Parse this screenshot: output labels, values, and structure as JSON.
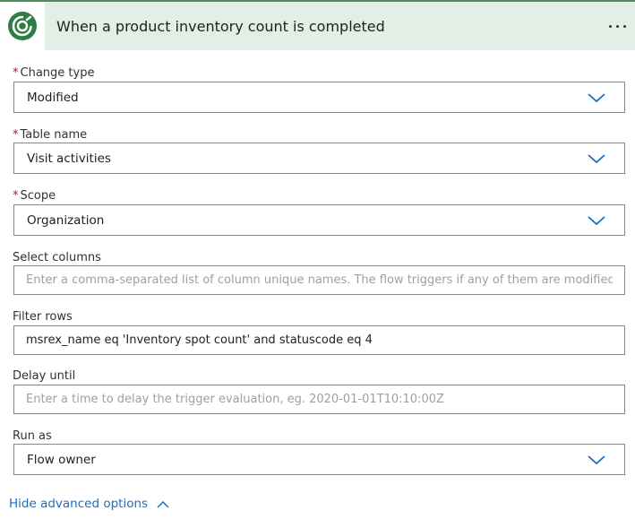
{
  "header": {
    "title": "When a product inventory count is completed",
    "logo": "dataverse-logo-icon",
    "more": "more-options-icon"
  },
  "colors": {
    "header_bg": "#e2efe6",
    "accent": "#2e7d44",
    "required": "#c50f1f",
    "link": "#1b6ec2"
  },
  "fields": {
    "change_type": {
      "required_mark": "*",
      "label": "Change type",
      "value": "Modified"
    },
    "table_name": {
      "required_mark": "*",
      "label": "Table name",
      "value": "Visit activities"
    },
    "scope": {
      "required_mark": "*",
      "label": "Scope",
      "value": "Organization"
    },
    "select_columns": {
      "label": "Select columns",
      "placeholder": "Enter a comma-separated list of column unique names. The flow triggers if any of them are modified",
      "value": ""
    },
    "filter_rows": {
      "label": "Filter rows",
      "value": "msrex_name eq 'Inventory spot count' and statuscode eq 4"
    },
    "delay_until": {
      "label": "Delay until",
      "placeholder": "Enter a time to delay the trigger evaluation, eg. 2020-01-01T10:10:00Z",
      "value": ""
    },
    "run_as": {
      "label": "Run as",
      "value": "Flow owner"
    }
  },
  "advanced": {
    "label": "Hide advanced options"
  }
}
